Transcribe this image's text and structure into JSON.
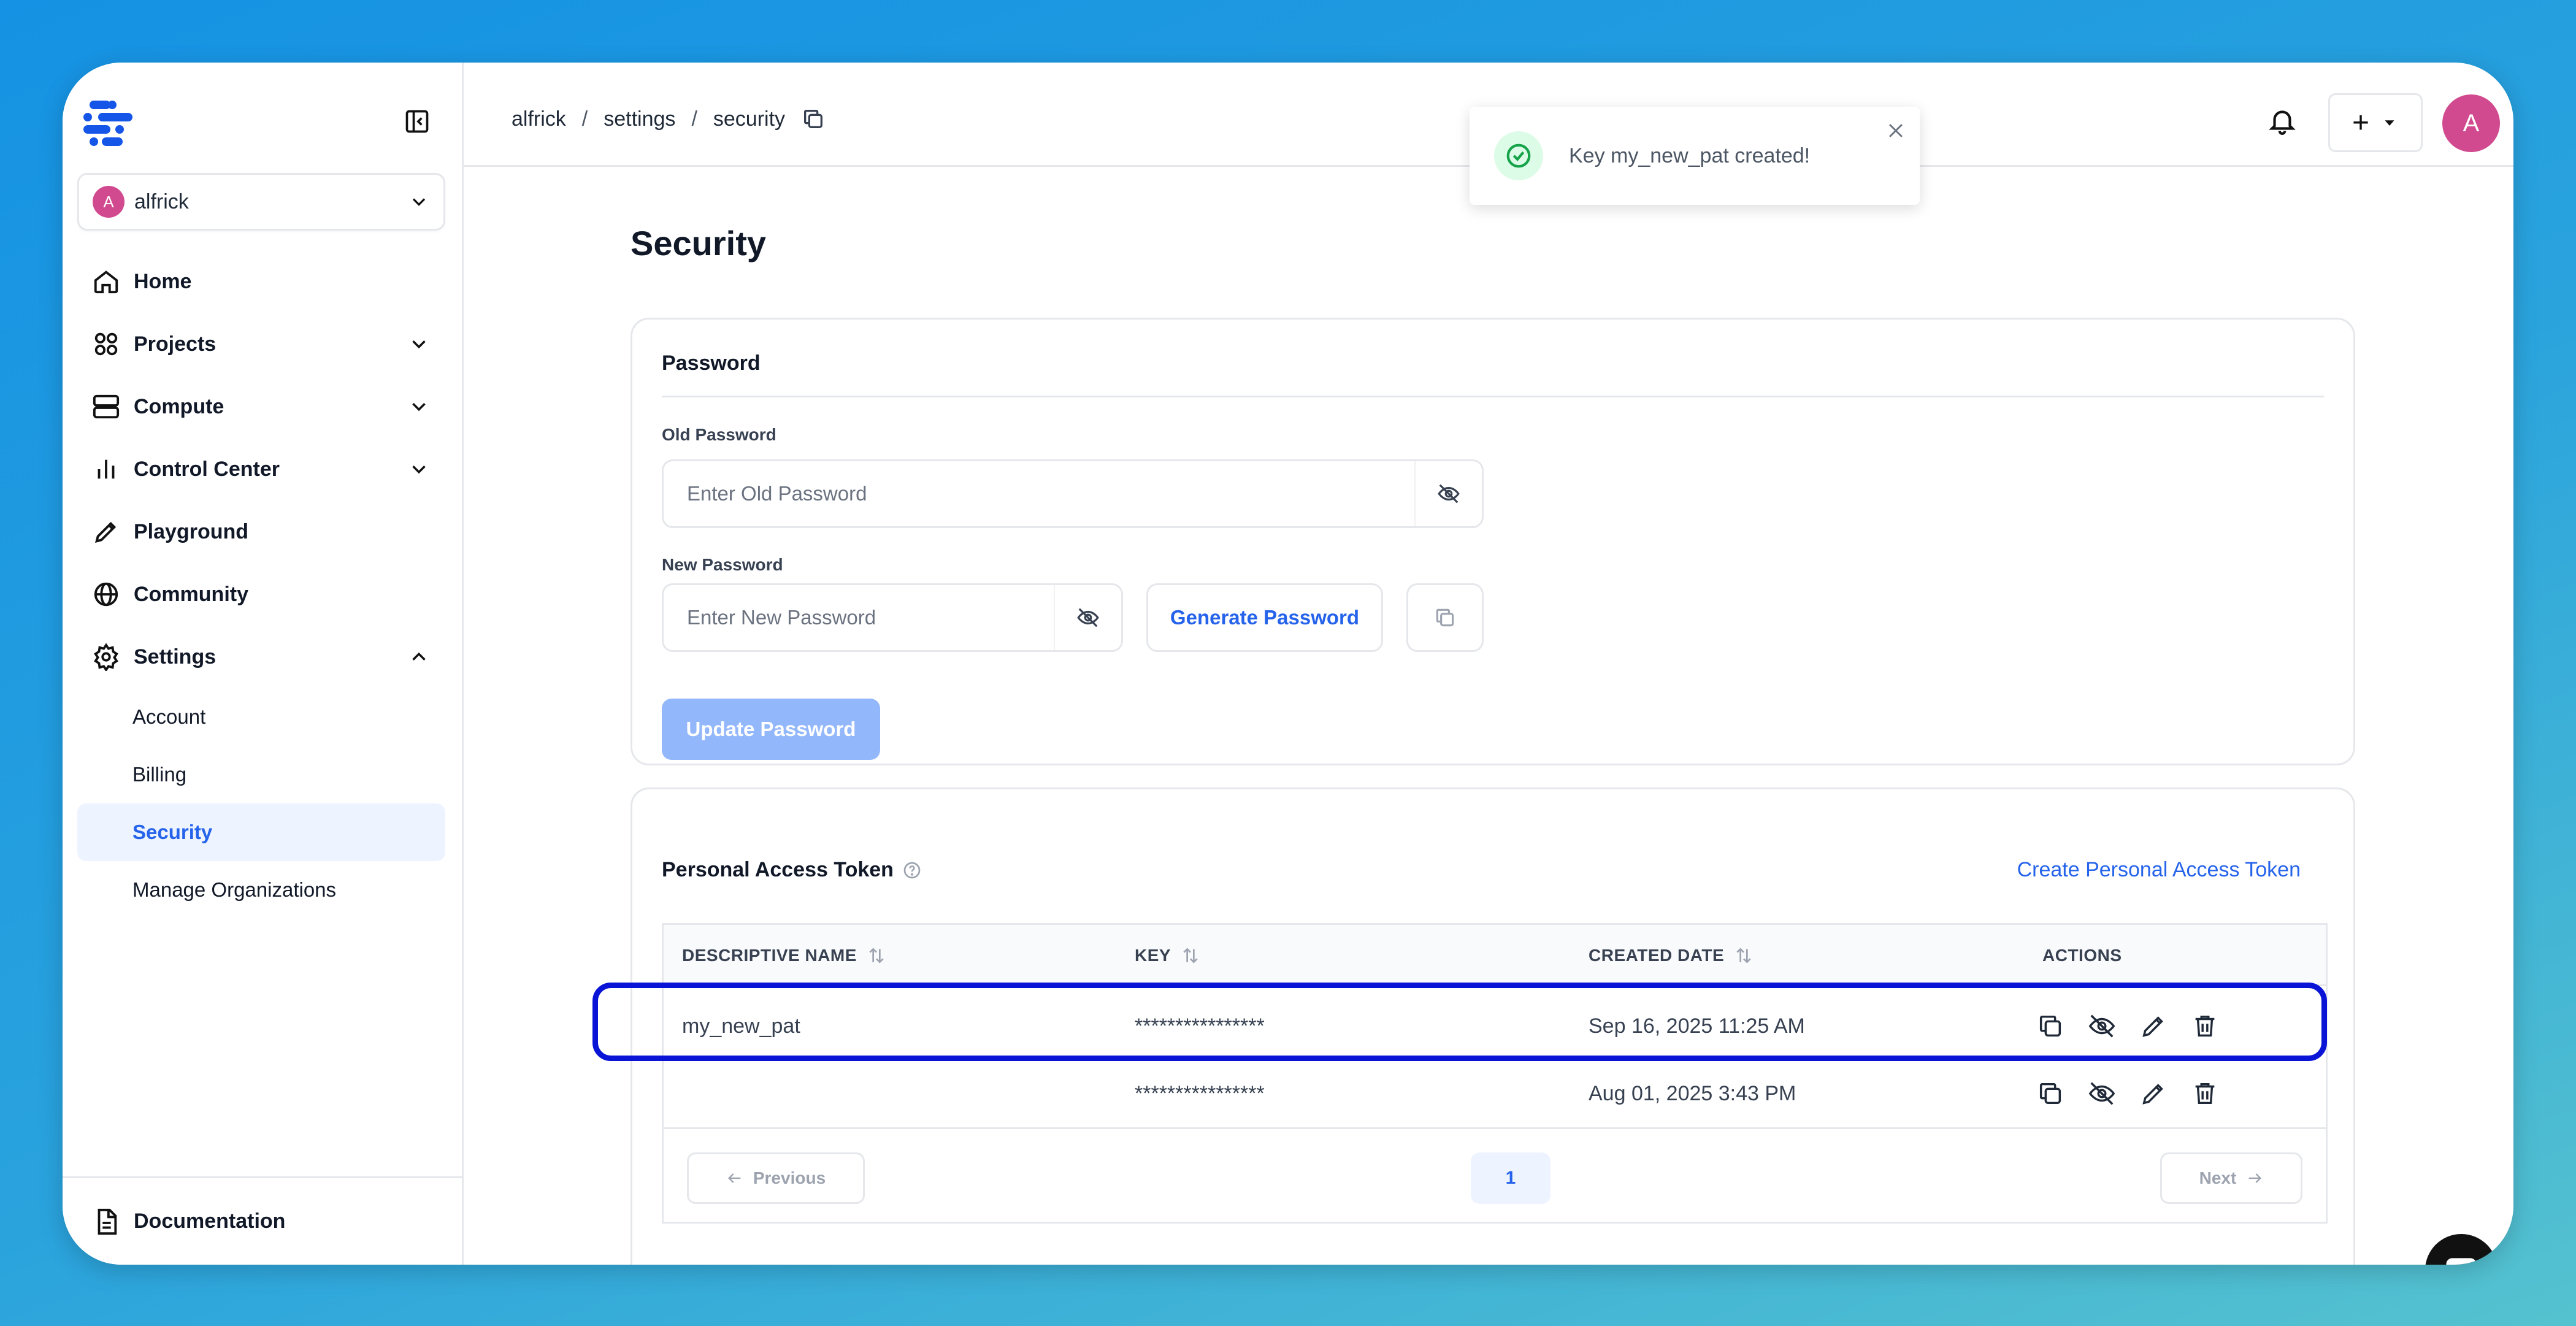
{
  "sidebar": {
    "org": {
      "initial": "A",
      "name": "alfrick"
    },
    "nav": [
      {
        "label": "Home"
      },
      {
        "label": "Projects"
      },
      {
        "label": "Compute"
      },
      {
        "label": "Control Center"
      },
      {
        "label": "Playground"
      },
      {
        "label": "Community"
      },
      {
        "label": "Settings"
      }
    ],
    "settings_sub": [
      {
        "label": "Account"
      },
      {
        "label": "Billing"
      },
      {
        "label": "Security"
      },
      {
        "label": "Manage Organizations"
      }
    ],
    "footer_label": "Documentation"
  },
  "topbar": {
    "breadcrumb": [
      "alfrick",
      "settings",
      "security"
    ],
    "separator": "/",
    "add_label": "+",
    "avatar_initial": "A"
  },
  "toast": {
    "message": "Key my_new_pat created!"
  },
  "page": {
    "title": "Security"
  },
  "password": {
    "title": "Password",
    "old_label": "Old Password",
    "old_placeholder": "Enter Old Password",
    "new_label": "New Password",
    "new_placeholder": "Enter New Password",
    "generate_label": "Generate Password",
    "update_label": "Update Password"
  },
  "pat": {
    "title": "Personal Access Token",
    "create_label": "Create Personal Access Token",
    "columns": [
      "DESCRIPTIVE NAME",
      "KEY",
      "CREATED DATE",
      "ACTIONS"
    ],
    "rows": [
      {
        "name": "my_new_pat",
        "key": "****************",
        "created": "Sep 16, 2025 11:25 AM"
      },
      {
        "name": "",
        "key": "****************",
        "created": "Aug 01, 2025 3:43 PM"
      }
    ],
    "pager": {
      "previous": "Previous",
      "page": "1",
      "next": "Next"
    }
  },
  "colors": {
    "accent": "#2563eb",
    "highlight": "#0a14d6",
    "avatar": "#d14a8f",
    "disabled_button": "#93b7fb"
  }
}
